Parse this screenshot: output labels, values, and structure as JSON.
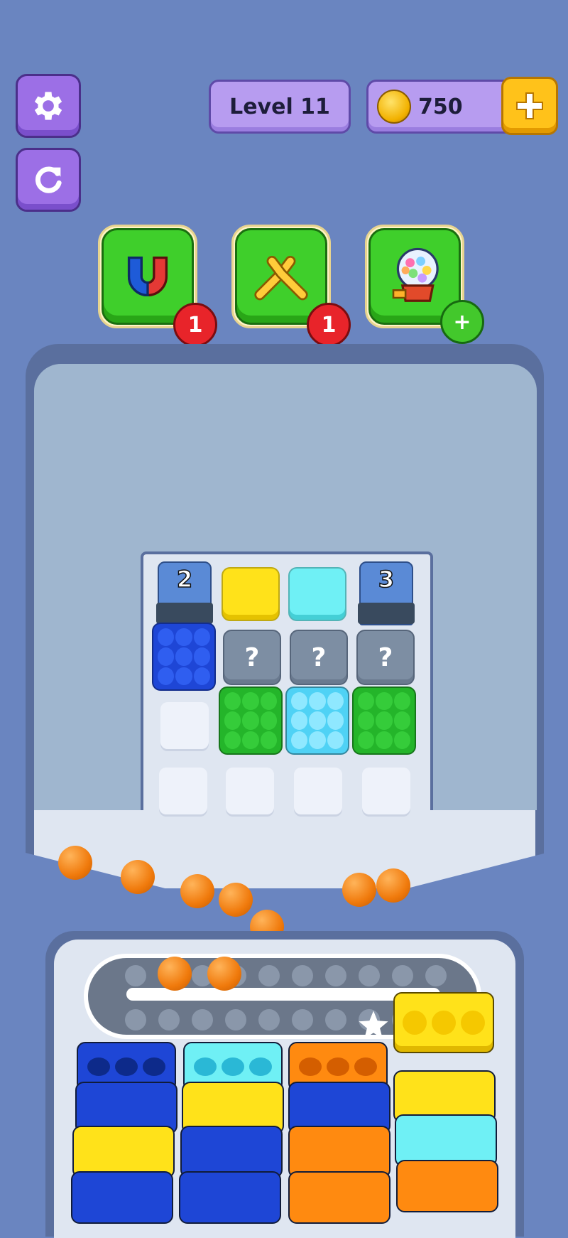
{
  "header": {
    "level_label": "Level 11",
    "coins": "750"
  },
  "boosters": [
    {
      "name": "magnet",
      "count": "1"
    },
    {
      "name": "shuffle",
      "count": "1"
    },
    {
      "name": "gumball",
      "count": "+"
    }
  ],
  "board": {
    "lock_left": "2",
    "lock_right": "3",
    "hidden_mark": "?"
  },
  "colors": {
    "background": "#6a85c0",
    "blue": "#1e46d6",
    "yellow": "#ffe21a",
    "cyan": "#6ff0f5",
    "green": "#24b52a",
    "orange": "#ff8a10"
  }
}
